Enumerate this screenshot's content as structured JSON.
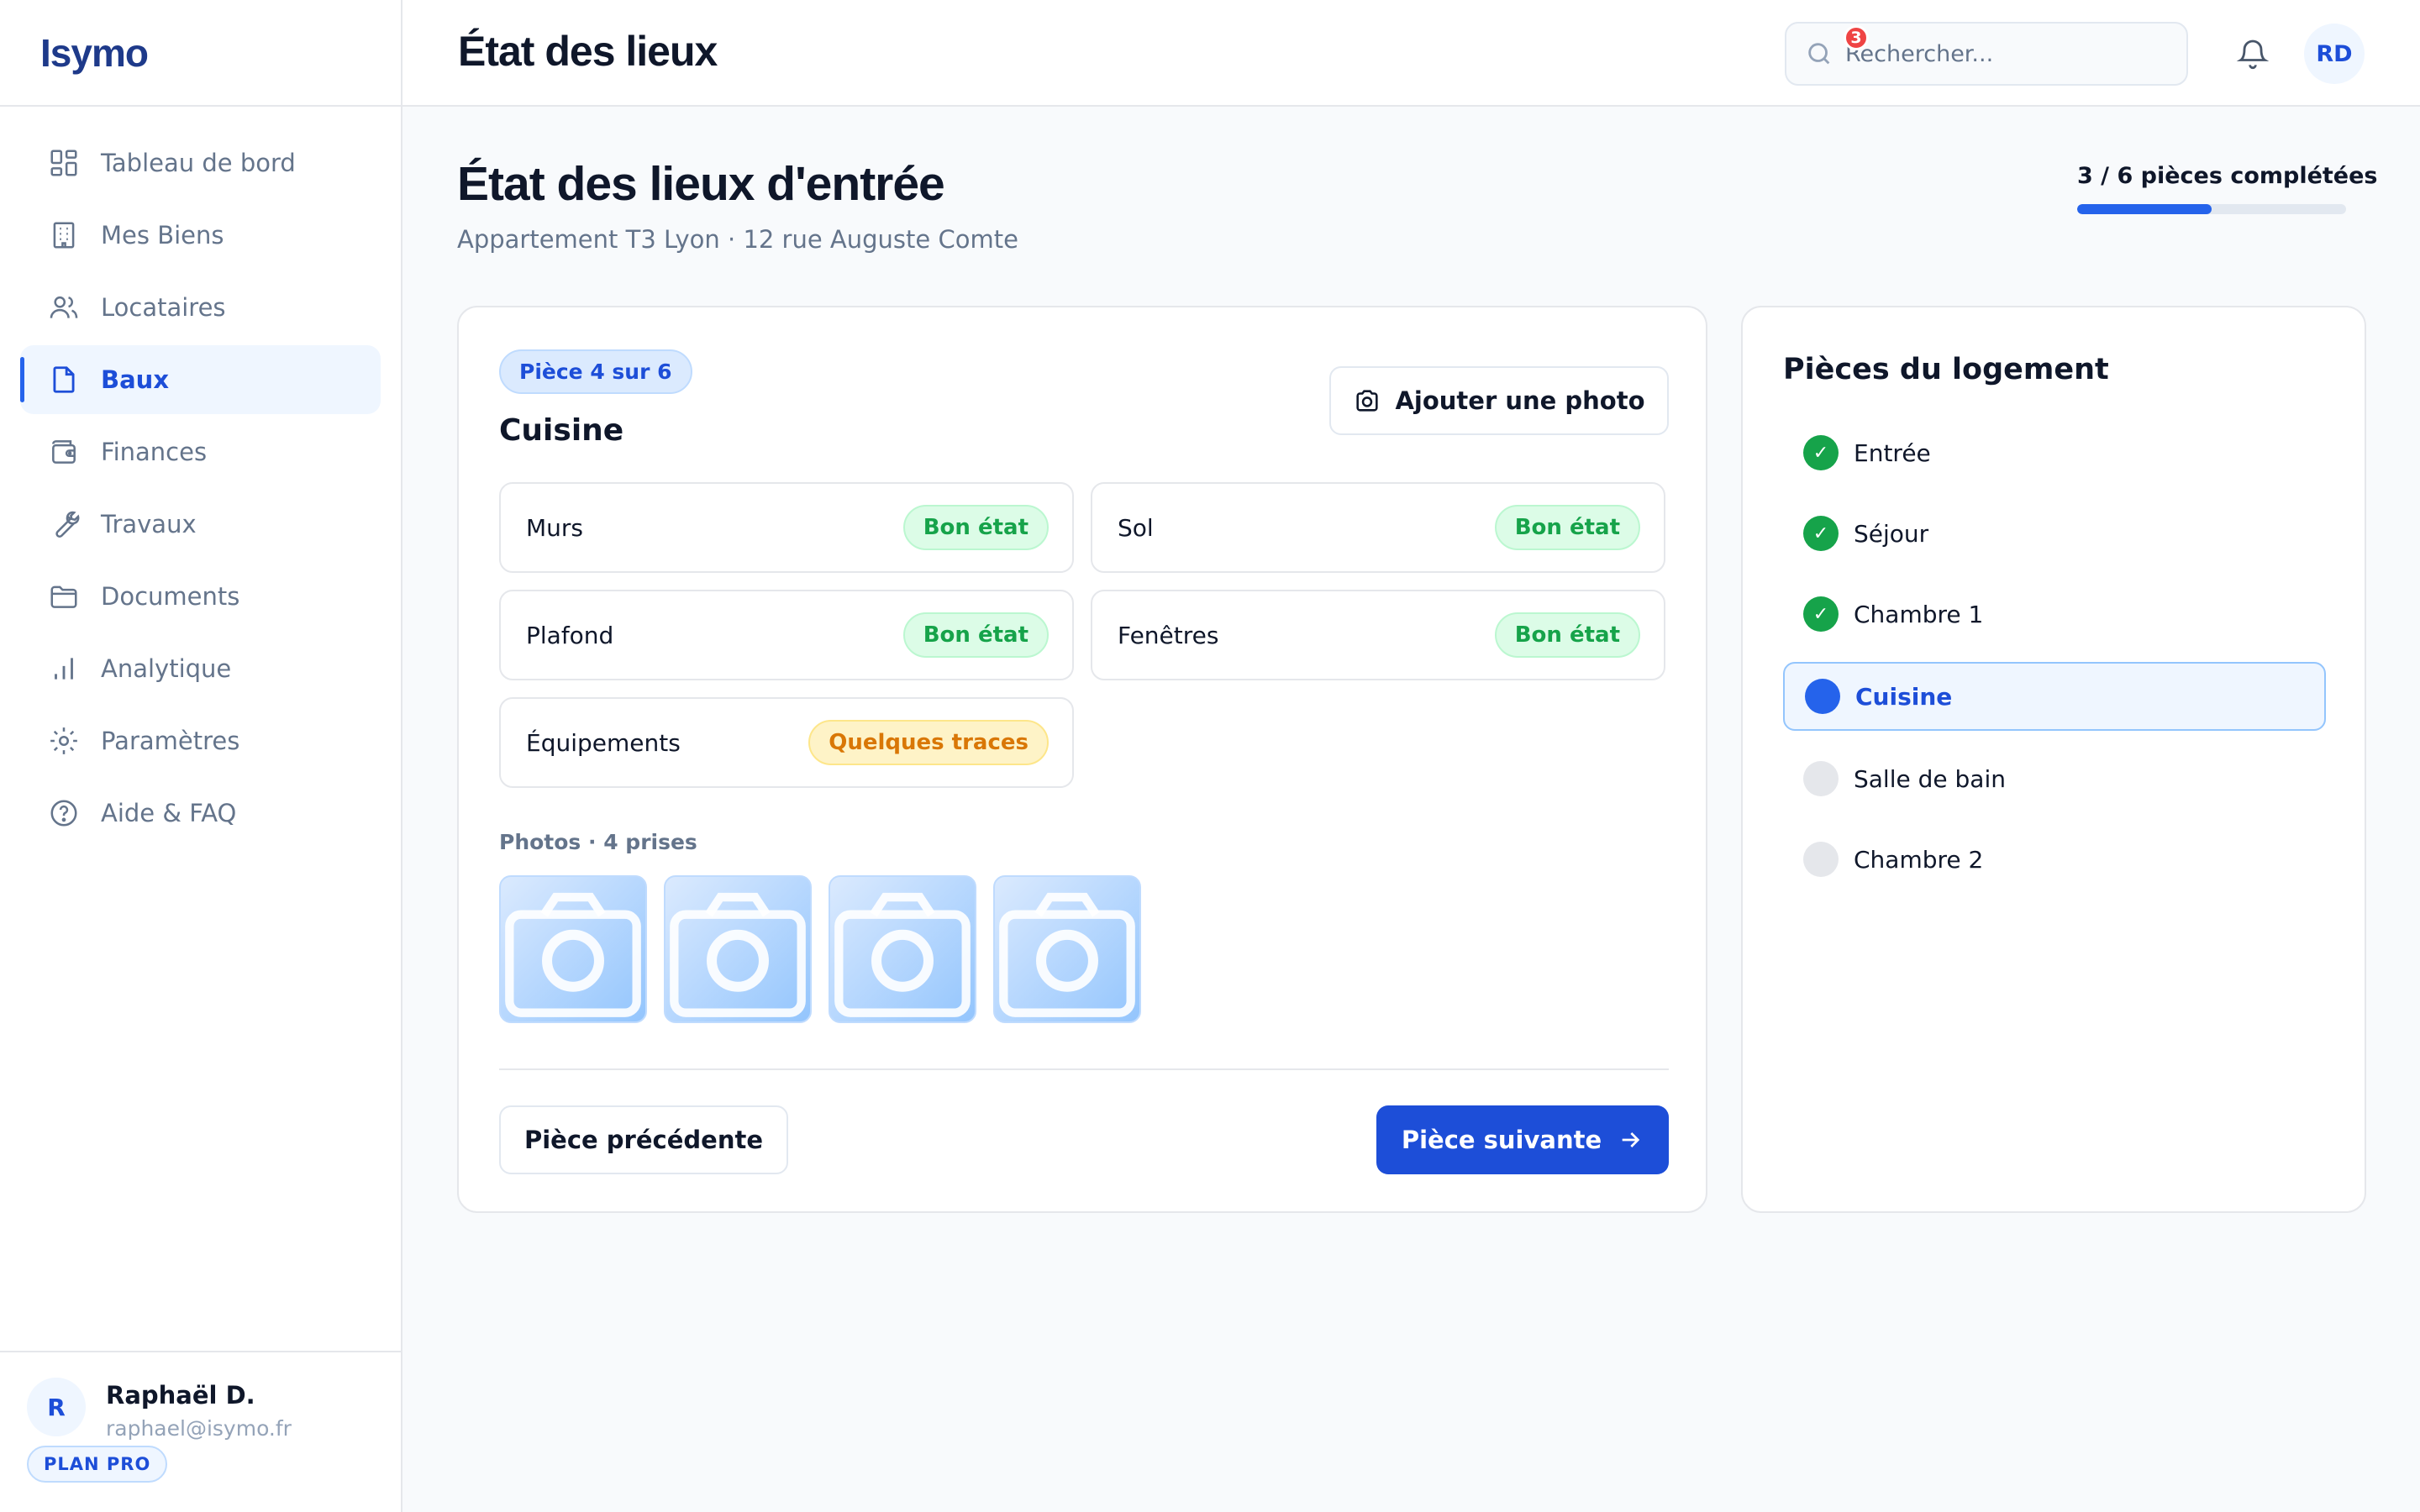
{
  "app": {
    "name": "Isymo"
  },
  "sidebar": {
    "items": [
      {
        "label": "Tableau de bord",
        "icon": "dashboard-icon"
      },
      {
        "label": "Mes Biens",
        "icon": "building-icon"
      },
      {
        "label": "Locataires",
        "icon": "users-icon"
      },
      {
        "label": "Baux",
        "icon": "document-icon",
        "active": true
      },
      {
        "label": "Finances",
        "icon": "wallet-icon"
      },
      {
        "label": "Travaux",
        "icon": "wrench-icon"
      },
      {
        "label": "Documents",
        "icon": "folder-icon"
      },
      {
        "label": "Analytique",
        "icon": "bar-chart-icon"
      },
      {
        "label": "Paramètres",
        "icon": "gear-icon"
      },
      {
        "label": "Aide & FAQ",
        "icon": "help-icon"
      }
    ],
    "user": {
      "initial": "R",
      "name": "Raphaël D.",
      "email": "raphael@isymo.fr",
      "plan": "PLAN PRO"
    }
  },
  "header": {
    "title": "État des lieux",
    "search_placeholder": "Rechercher...",
    "notifications_count": "3",
    "avatar_initials": "RD"
  },
  "main": {
    "title": "État des lieux d'entrée",
    "subtitle": "Appartement T3 Lyon · 12 rue Auguste Comte",
    "progress": {
      "label": "3 / 6 pièces complétées",
      "completed": 3,
      "total": 6
    }
  },
  "room": {
    "badge": "Pièce 4 sur 6",
    "name": "Cuisine",
    "add_photo_label": "Ajouter une photo",
    "items": [
      {
        "name": "Murs",
        "status": "Bon état",
        "tone": "good"
      },
      {
        "name": "Sol",
        "status": "Bon état",
        "tone": "good"
      },
      {
        "name": "Plafond",
        "status": "Bon état",
        "tone": "good"
      },
      {
        "name": "Fenêtres",
        "status": "Bon état",
        "tone": "good"
      },
      {
        "name": "Équipements",
        "status": "Quelques traces",
        "tone": "warn"
      }
    ],
    "photos_label": "Photos · 4 prises",
    "photo_count": 4,
    "prev_label": "Pièce précédente",
    "next_label": "Pièce suivante"
  },
  "rooms_panel": {
    "title": "Pièces du logement",
    "rooms": [
      {
        "label": "Entrée",
        "state": "done"
      },
      {
        "label": "Séjour",
        "state": "done"
      },
      {
        "label": "Chambre 1",
        "state": "done"
      },
      {
        "label": "Cuisine",
        "state": "current"
      },
      {
        "label": "Salle de bain",
        "state": "todo"
      },
      {
        "label": "Chambre 2",
        "state": "todo"
      }
    ],
    "check_glyph": "✓"
  },
  "colors": {
    "primary": "#1d4ed8",
    "success": "#16a34a",
    "warning": "#d97706",
    "danger": "#ef4444"
  }
}
